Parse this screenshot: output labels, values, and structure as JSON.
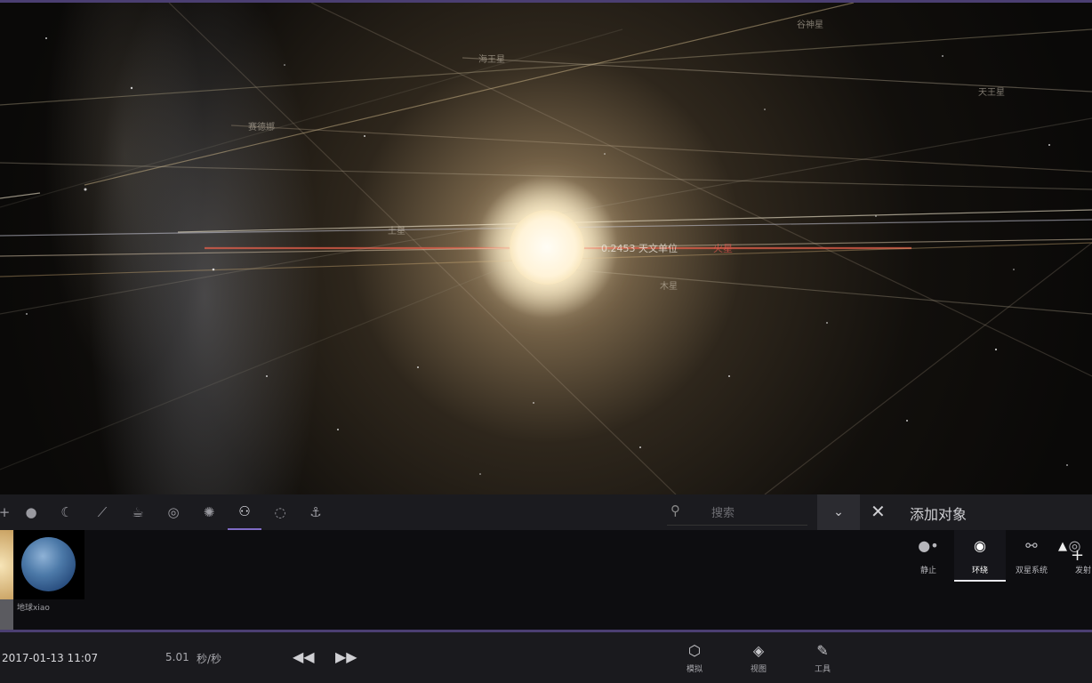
{
  "viewport": {
    "labels": {
      "planet_a": "海王星",
      "planet_b": "天王星",
      "planet_c": "土星",
      "planet_d": "木星",
      "planet_e": "谷神星",
      "planet_f": "赛德娜",
      "distance": "0.2453 天文单位",
      "distance_suffix": "火星"
    }
  },
  "toolbar": {
    "categories": [
      "add",
      "planet",
      "moon",
      "comet",
      "teapot",
      "galaxy",
      "star",
      "people",
      "dust",
      "launcher"
    ],
    "search_placeholder": "搜索",
    "dropdown_icon": "chevron-down-icon"
  },
  "panel": {
    "title": "添加对象",
    "close_icon": "close-icon"
  },
  "objects": [
    {
      "label": "地球xiao"
    }
  ],
  "modes": [
    {
      "label": "静止",
      "icon": "static-icon"
    },
    {
      "label": "环绕",
      "icon": "orbit-icon",
      "active": true
    },
    {
      "label": "双星系统",
      "icon": "binary-icon"
    },
    {
      "label": "发射",
      "icon": "launch-icon"
    }
  ],
  "bottombar": {
    "datetime": "2017-01-13 11:07",
    "speed": "5.01",
    "speed_unit": "秒/秒",
    "buttons": [
      {
        "label": "模拟",
        "icon": "cube-icon"
      },
      {
        "label": "视图",
        "icon": "layers-icon"
      },
      {
        "label": "工具",
        "icon": "wrench-icon"
      }
    ]
  },
  "colors": {
    "accent": "#7e6bc4",
    "strip": "#4b3f72"
  }
}
